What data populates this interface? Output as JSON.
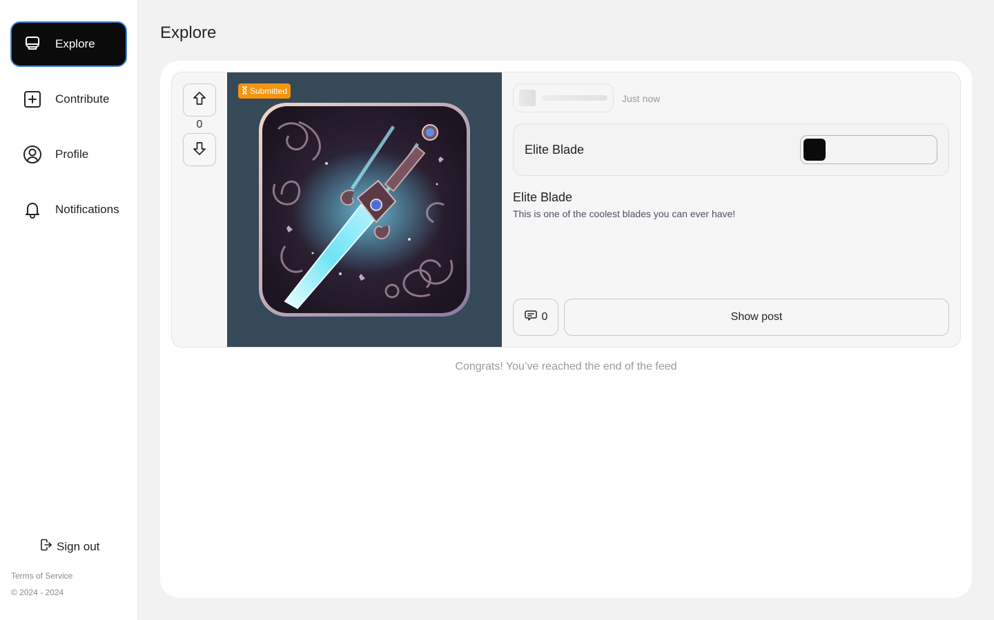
{
  "sidebar": {
    "items": [
      {
        "label": "Explore",
        "icon": "explore-icon",
        "active": true
      },
      {
        "label": "Contribute",
        "icon": "plus-square-icon",
        "active": false
      },
      {
        "label": "Profile",
        "icon": "user-circle-icon",
        "active": false
      },
      {
        "label": "Notifications",
        "icon": "bell-icon",
        "active": false
      }
    ],
    "sign_out": "Sign out",
    "terms": "Terms of Service",
    "copyright": "© 2024 - 2024"
  },
  "main": {
    "title": "Explore",
    "post": {
      "votes": "0",
      "status_badge": "Submitted",
      "time": "Just now",
      "item_name": "Elite Blade",
      "title": "Elite Blade",
      "description": "This is one of the coolest blades you can ever have!",
      "comment_count": "0",
      "show_post_label": "Show post",
      "image_bg": "#364959",
      "badge_color": "#f5930f"
    },
    "end_message": "Congrats! You’ve reached the end of the feed"
  }
}
